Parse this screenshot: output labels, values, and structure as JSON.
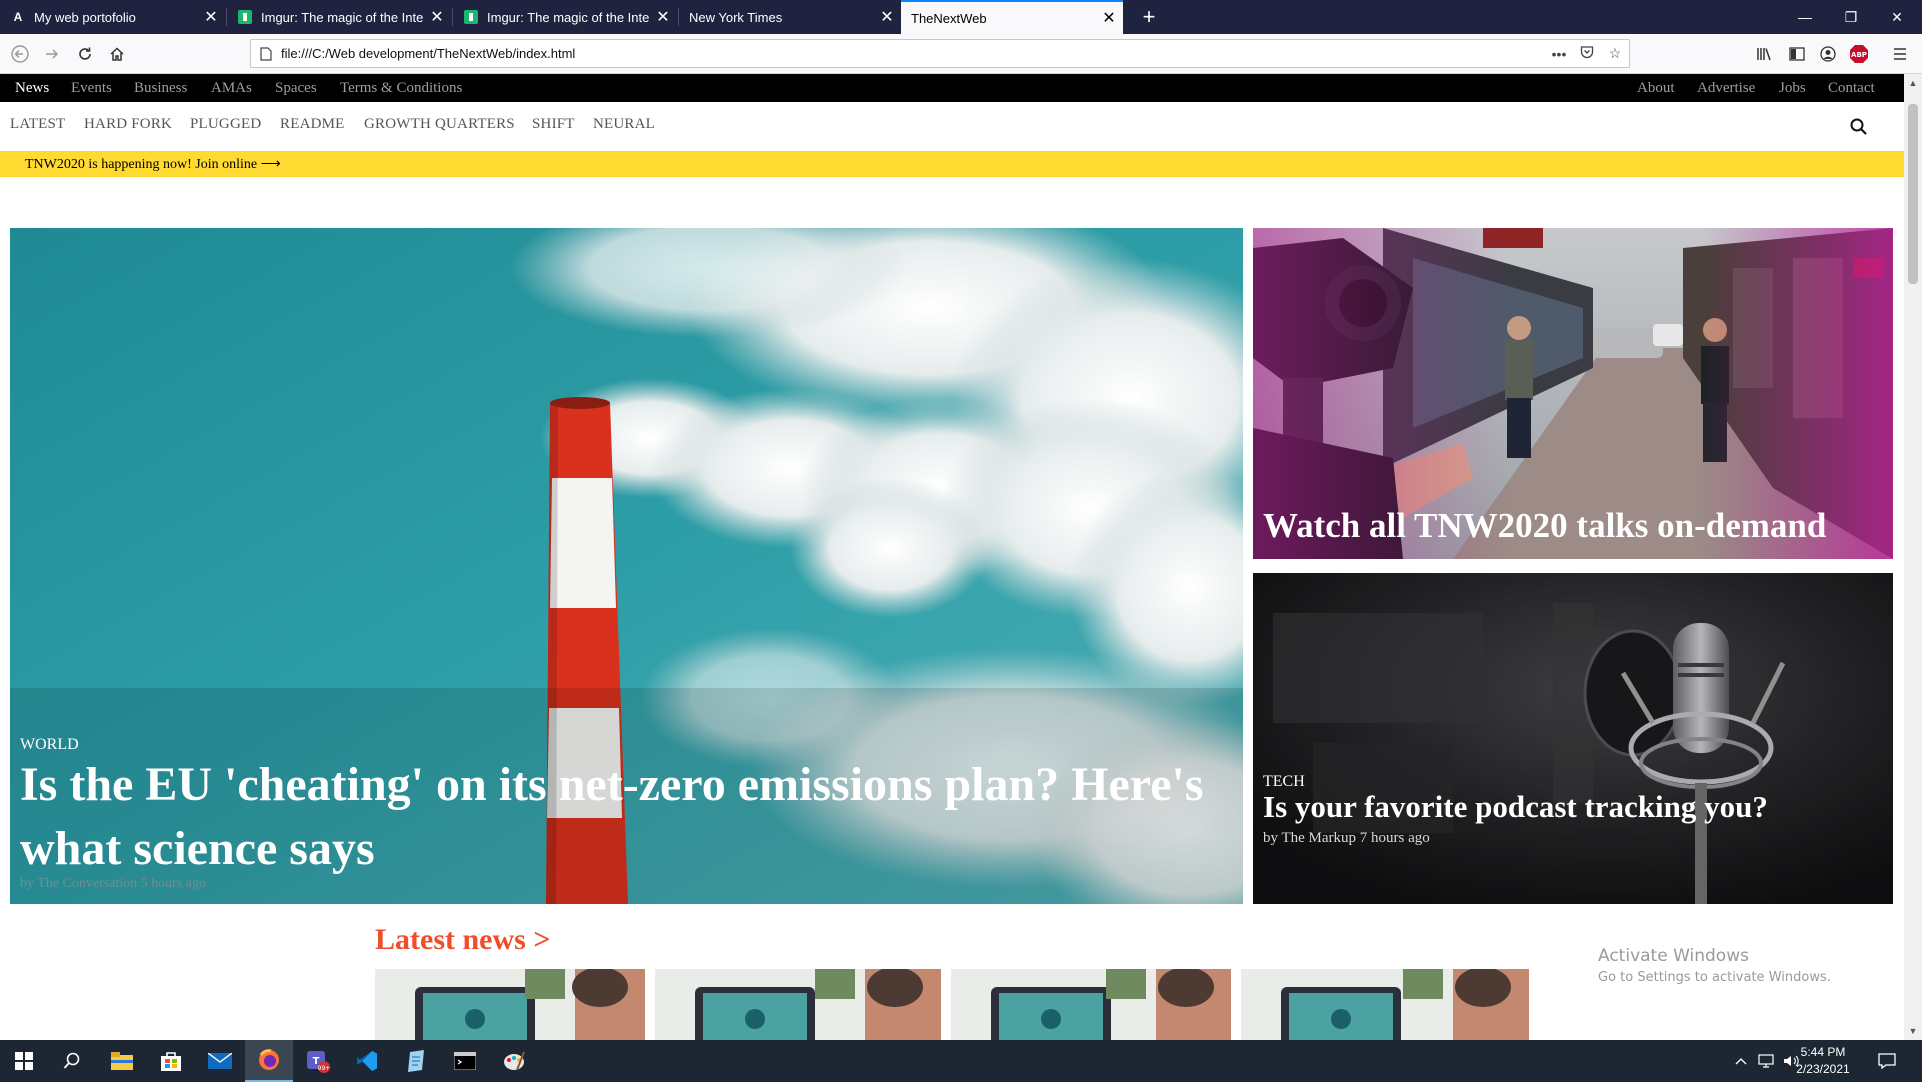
{
  "browser": {
    "tabs": [
      {
        "title": "My web portofolio",
        "icon": "letter-a-icon",
        "active": false
      },
      {
        "title": "Imgur: The magic of the Interne",
        "icon": "imgur-icon",
        "active": false
      },
      {
        "title": "Imgur: The magic of the Interne",
        "icon": "imgur-icon",
        "active": false
      },
      {
        "title": "New York Times",
        "icon": "",
        "active": false
      },
      {
        "title": "TheNextWeb",
        "icon": "",
        "active": true
      }
    ],
    "url": "file:///C:/Web development/TheNextWeb/index.html",
    "toolbar_icons": [
      "library-icon",
      "sidebar-icon",
      "account-icon",
      "adblock-icon",
      "menu-icon"
    ],
    "adblock_label": "ABP"
  },
  "site": {
    "top_nav_left": [
      "News",
      "Events",
      "Business",
      "AMAs",
      "Spaces",
      "Terms & Conditions"
    ],
    "top_nav_right": [
      "About",
      "Advertise",
      "Jobs",
      "Contact"
    ],
    "section_nav": [
      "LATEST",
      "HARD FORK",
      "PLUGGED",
      "README",
      "GROWTH QUARTERS",
      "SHIFT",
      "NEURAL"
    ],
    "banner": "TNW2020 is happening now! Join online ⟶",
    "hero": {
      "category": "WORLD",
      "headline": "Is the EU 'cheating' on its net-zero emissions plan? Here's what science says",
      "byline": "by The Conversation 5 hours ago"
    },
    "side_top": {
      "headline": "Watch all TNW2020 talks on-demand"
    },
    "side_bottom": {
      "category": "TECH",
      "headline": "Is your favorite podcast tracking you?",
      "byline": "by The Markup 7 hours ago"
    },
    "latest_title": "Latest news >",
    "colors": {
      "banner": "#ffdb32",
      "accent": "#f04d29",
      "topnav": "#000000"
    }
  },
  "watermark": {
    "title": "Activate Windows",
    "subtitle": "Go to Settings to activate Windows."
  },
  "taskbar": {
    "apps": [
      "windows-start-icon",
      "search-icon",
      "file-explorer-icon",
      "store-icon",
      "mail-icon",
      "firefox-icon",
      "teams-icon",
      "vscode-icon",
      "notepad-icon",
      "terminal-icon",
      "paint-icon"
    ],
    "time": "5:44 PM",
    "date": "2/23/2021",
    "badge": "99+"
  }
}
